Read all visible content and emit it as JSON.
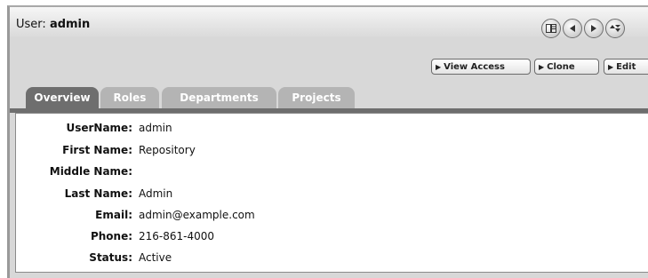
{
  "header": {
    "title_prefix": "User:",
    "title_name": "admin",
    "nav_icons": [
      "layout-icon",
      "arrow-left-icon",
      "arrow-right-icon",
      "sort-icon"
    ]
  },
  "actions": [
    {
      "label": "View Access",
      "icon": "play-icon"
    },
    {
      "label": "Clone",
      "icon": "play-icon"
    },
    {
      "label": "Edit",
      "icon": "play-icon"
    }
  ],
  "tabs": [
    {
      "label": "Overview",
      "active": true
    },
    {
      "label": "Roles",
      "active": false
    },
    {
      "label": "Departments",
      "active": false
    },
    {
      "label": "Projects",
      "active": false
    }
  ],
  "details": [
    {
      "label": "UserName:",
      "value": "admin"
    },
    {
      "label": "First Name:",
      "value": "Repository"
    },
    {
      "label": "Middle Name:",
      "value": ""
    },
    {
      "label": "Last Name:",
      "value": "Admin"
    },
    {
      "label": "Email:",
      "value": "admin@example.com"
    },
    {
      "label": "Phone:",
      "value": "216-861-4000"
    },
    {
      "label": "Status:",
      "value": "Active"
    }
  ],
  "colors": {
    "active_tab": "#6e6e6e",
    "inactive_tab": "#b4b4b4",
    "chrome_bg": "#d8d8d8"
  }
}
